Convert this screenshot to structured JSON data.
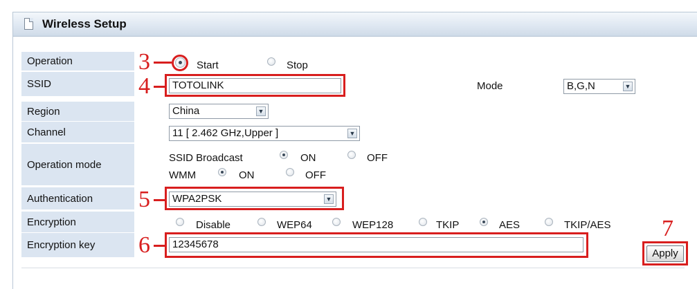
{
  "window": {
    "title": "Wireless Setup"
  },
  "operation": {
    "label": "Operation",
    "options": [
      "Start",
      "Stop"
    ],
    "selected": "Start"
  },
  "ssid": {
    "label": "SSID",
    "value": "TOTOLINK"
  },
  "mode": {
    "label": "Mode",
    "value": "B,G,N"
  },
  "region": {
    "label": "Region",
    "value": "China"
  },
  "channel": {
    "label": "Channel",
    "value": "11 [ 2.462 GHz,Upper ]"
  },
  "operation_mode": {
    "label": "Operation mode",
    "ssid_broadcast": {
      "label": "SSID Broadcast",
      "on_label": "ON",
      "off_label": "OFF",
      "selected": "ON"
    },
    "wmm": {
      "label": "WMM",
      "on_label": "ON",
      "off_label": "OFF",
      "selected": "ON"
    }
  },
  "authentication": {
    "label": "Authentication",
    "value": "WPA2PSK"
  },
  "encryption": {
    "label": "Encryption",
    "options": [
      "Disable",
      "WEP64",
      "WEP128",
      "TKIP",
      "AES",
      "TKIP/AES"
    ],
    "selected": "AES"
  },
  "encryption_key": {
    "label": "Encryption key",
    "value": "12345678"
  },
  "apply_label": "Apply",
  "annotations": {
    "step3": "3",
    "step4": "4",
    "step5": "5",
    "step6": "6",
    "step7": "7"
  },
  "colors": {
    "label_bg": "#dbe5f1",
    "highlight": "#d81e1e",
    "title_bar": "#dfe8f2"
  },
  "icons": {
    "title": "document-icon",
    "select": "chevron-down-icon"
  }
}
